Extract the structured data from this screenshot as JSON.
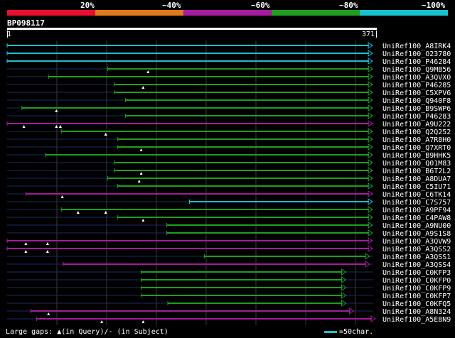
{
  "legend": {
    "labels": [
      "20%",
      "~40%",
      "~60%",
      "~80%",
      "~100%"
    ],
    "colors": [
      "#e8102e",
      "#e07a1a",
      "#a41c9d",
      "#1f9e1f",
      "#19c1cf"
    ]
  },
  "query": {
    "id": "BP098117",
    "start": "1",
    "end": "371",
    "length": 371
  },
  "hits": [
    {
      "label": "UniRef100_A8IRK4",
      "color": "#19c1cf",
      "start": 1,
      "end": 371,
      "gaps": []
    },
    {
      "label": "UniRef100_O23780",
      "color": "#19c1cf",
      "start": 1,
      "end": 371,
      "gaps": []
    },
    {
      "label": "UniRef100_P46284",
      "color": "#19c1cf",
      "start": 1,
      "end": 371,
      "gaps": []
    },
    {
      "label": "UniRef100_Q9MB56",
      "color": "#1f9e1f",
      "start": 103,
      "end": 371,
      "gaps": [
        144
      ]
    },
    {
      "label": "UniRef100_A3QVX0",
      "color": "#1f9e1f",
      "start": 43,
      "end": 371,
      "gaps": []
    },
    {
      "label": "UniRef100_P46285",
      "color": "#1f9e1f",
      "start": 110,
      "end": 371,
      "gaps": [
        139
      ]
    },
    {
      "label": "UniRef100_C5XPV6",
      "color": "#1f9e1f",
      "start": 110,
      "end": 371,
      "gaps": []
    },
    {
      "label": "UniRef100_Q940F8",
      "color": "#1f9e1f",
      "start": 121,
      "end": 371,
      "gaps": []
    },
    {
      "label": "UniRef100_B9SWP6",
      "color": "#1f9e1f",
      "start": 16,
      "end": 371,
      "gaps": [
        51
      ]
    },
    {
      "label": "UniRef100_P46283",
      "color": "#1f9e1f",
      "start": 121,
      "end": 371,
      "gaps": []
    },
    {
      "label": "UniRef100_A9U222",
      "color": "#a41c9d",
      "start": 1,
      "end": 371,
      "gaps": [
        18,
        51,
        55
      ]
    },
    {
      "label": "UniRef100_Q2Q252",
      "color": "#1f9e1f",
      "start": 56,
      "end": 371,
      "gaps": [
        101
      ]
    },
    {
      "label": "UniRef100_A7R8H0",
      "color": "#1f9e1f",
      "start": 113,
      "end": 371,
      "gaps": []
    },
    {
      "label": "UniRef100_Q7XRT0",
      "color": "#1f9e1f",
      "start": 113,
      "end": 371,
      "gaps": [
        137
      ]
    },
    {
      "label": "UniRef100_B9HHK5",
      "color": "#1f9e1f",
      "start": 40,
      "end": 371,
      "gaps": []
    },
    {
      "label": "UniRef100_Q01M83",
      "color": "#1f9e1f",
      "start": 110,
      "end": 371,
      "gaps": []
    },
    {
      "label": "UniRef100_B6T2L2",
      "color": "#1f9e1f",
      "start": 110,
      "end": 371,
      "gaps": [
        137
      ]
    },
    {
      "label": "UniRef100_A8DUA7",
      "color": "#1f9e1f",
      "start": 103,
      "end": 371,
      "gaps": [
        135
      ]
    },
    {
      "label": "UniRef100_C5IU71",
      "color": "#1f9e1f",
      "start": 113,
      "end": 371,
      "gaps": []
    },
    {
      "label": "UniRef100_C6TK14",
      "color": "#a41c9d",
      "start": 20,
      "end": 371,
      "gaps": [
        57
      ]
    },
    {
      "label": "UniRef100_C7S757",
      "color": "#19c1cf",
      "start": 186,
      "end": 371,
      "gaps": []
    },
    {
      "label": "UniRef100_A9PF94",
      "color": "#1f9e1f",
      "start": 56,
      "end": 371,
      "gaps": [
        73,
        101
      ]
    },
    {
      "label": "UniRef100_C4PAW8",
      "color": "#1f9e1f",
      "start": 113,
      "end": 371,
      "gaps": [
        139
      ]
    },
    {
      "label": "UniRef100_A9NU00",
      "color": "#1f9e1f",
      "start": 163,
      "end": 371,
      "gaps": []
    },
    {
      "label": "UniRef100_A9S1S8",
      "color": "#1f9e1f",
      "start": 163,
      "end": 371,
      "gaps": []
    },
    {
      "label": "UniRef100_A3QVW9",
      "color": "#a41c9d",
      "start": 1,
      "end": 371,
      "gaps": [
        20,
        42
      ]
    },
    {
      "label": "UniRef100_A3QSS2",
      "color": "#a41c9d",
      "start": 1,
      "end": 371,
      "gaps": [
        20,
        42
      ]
    },
    {
      "label": "UniRef100_A3QSS1",
      "color": "#1f9e1f",
      "start": 201,
      "end": 368,
      "gaps": []
    },
    {
      "label": "UniRef100_A3QSS4",
      "color": "#a41c9d",
      "start": 58,
      "end": 368,
      "gaps": []
    },
    {
      "label": "UniRef100_C0KFP3",
      "color": "#1f9e1f",
      "start": 137,
      "end": 344,
      "gaps": []
    },
    {
      "label": "UniRef100_C0KFP0",
      "color": "#1f9e1f",
      "start": 137,
      "end": 344,
      "gaps": []
    },
    {
      "label": "UniRef100_C0KFP9",
      "color": "#1f9e1f",
      "start": 137,
      "end": 344,
      "gaps": []
    },
    {
      "label": "UniRef100_C0KFP7",
      "color": "#1f9e1f",
      "start": 137,
      "end": 344,
      "gaps": []
    },
    {
      "label": "UniRef100_C0KFQ5",
      "color": "#1f9e1f",
      "start": 164,
      "end": 344,
      "gaps": []
    },
    {
      "label": "UniRef100_A8N324",
      "color": "#a41c9d",
      "start": 25,
      "end": 352,
      "gaps": [
        43
      ]
    },
    {
      "label": "UniRef100_A5E8N9",
      "color": "#a41c9d",
      "start": 31,
      "end": 384,
      "gaps": [
        97,
        139
      ]
    }
  ],
  "footer": {
    "text": "Large gaps: ▲(in Query)/- (in Subject)"
  },
  "scale": {
    "text": "=50char."
  }
}
